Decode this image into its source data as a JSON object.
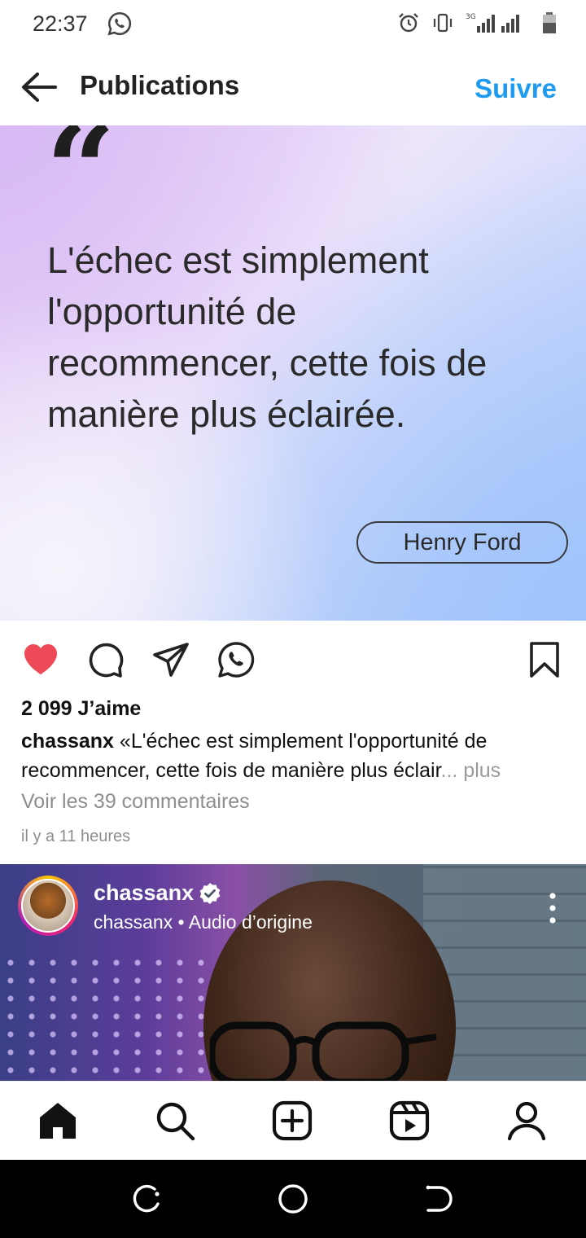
{
  "status_bar": {
    "time": "22:37",
    "icons": [
      "whatsapp-icon",
      "alarm-icon",
      "vibrate-icon",
      "signal-icon",
      "battery-icon"
    ],
    "network": "3G"
  },
  "header": {
    "title": "Publications",
    "follow_label": "Suivre",
    "accent_color": "#1d9bf0"
  },
  "post": {
    "quote_mark": "“",
    "quote": "L'échec est simplement l'opportunité de recommencer, cette fois de manière plus éclairée.",
    "author": "Henry Ford",
    "likes": "2 099 J’aime",
    "username": "chassanx",
    "caption": "«L'échec est simplement l'opportunité de recommencer, cette fois de manière plus éclair",
    "ellipsis_more": "... plus",
    "comments_link": "Voir les 39 commentaires",
    "time_ago": "il y a 11 heures",
    "liked": true,
    "like_color": "#ed4956"
  },
  "reel": {
    "username": "chassanx",
    "subtitle": "chassanx  •  Audio d’origine",
    "verified": true
  },
  "bottom_nav": [
    "home-icon",
    "search-icon",
    "create-icon",
    "reels-icon",
    "profile-icon"
  ],
  "system_nav": [
    "recents-icon",
    "home-circle-icon",
    "back-icon"
  ]
}
